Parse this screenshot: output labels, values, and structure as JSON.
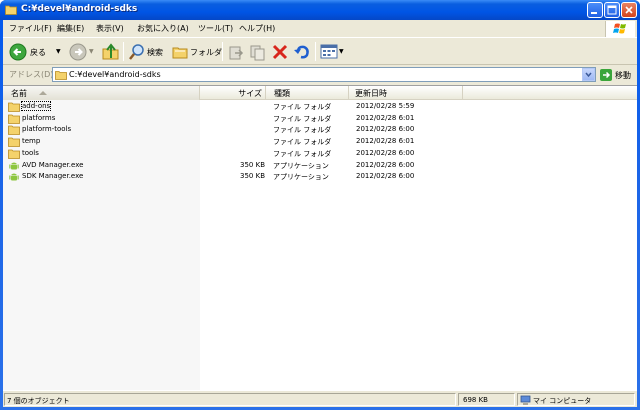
{
  "window": {
    "title": "C:¥devel¥android-sdks"
  },
  "menu": {
    "items": [
      "ファイル(F)",
      "編集(E)",
      "表示(V)",
      "お気に入り(A)",
      "ツール(T)",
      "ヘルプ(H)"
    ]
  },
  "toolbar": {
    "back_label": "戻る",
    "search_label": "検索",
    "folders_label": "フォルダ"
  },
  "address": {
    "label": "アドレス(D)",
    "value": "C:¥devel¥android-sdks",
    "go_label": "移動"
  },
  "columns": {
    "name": "名前",
    "size": "サイズ",
    "type": "種類",
    "modified": "更新日時"
  },
  "files": [
    {
      "name": "add-ons",
      "size": "",
      "type": "ファイル フォルダ",
      "modified": "2012/02/28 5:59",
      "icon": "folder-icon"
    },
    {
      "name": "platforms",
      "size": "",
      "type": "ファイル フォルダ",
      "modified": "2012/02/28 6:01",
      "icon": "folder-icon"
    },
    {
      "name": "platform-tools",
      "size": "",
      "type": "ファイル フォルダ",
      "modified": "2012/02/28 6:00",
      "icon": "folder-icon"
    },
    {
      "name": "temp",
      "size": "",
      "type": "ファイル フォルダ",
      "modified": "2012/02/28 6:01",
      "icon": "folder-icon"
    },
    {
      "name": "tools",
      "size": "",
      "type": "ファイル フォルダ",
      "modified": "2012/02/28 6:00",
      "icon": "folder-icon"
    },
    {
      "name": "AVD Manager.exe",
      "size": "350 KB",
      "type": "アプリケーション",
      "modified": "2012/02/28 6:00",
      "icon": "android-icon"
    },
    {
      "name": "SDK Manager.exe",
      "size": "350 KB",
      "type": "アプリケーション",
      "modified": "2012/02/28 6:00",
      "icon": "android-icon"
    }
  ],
  "status": {
    "objects": "7 個のオブジェクト",
    "size": "698 KB",
    "location": "マイ コンピュータ"
  },
  "colors": {
    "titlebar": "#0055E5",
    "client": "#ECE9D8",
    "folder": "#F4D26B"
  }
}
